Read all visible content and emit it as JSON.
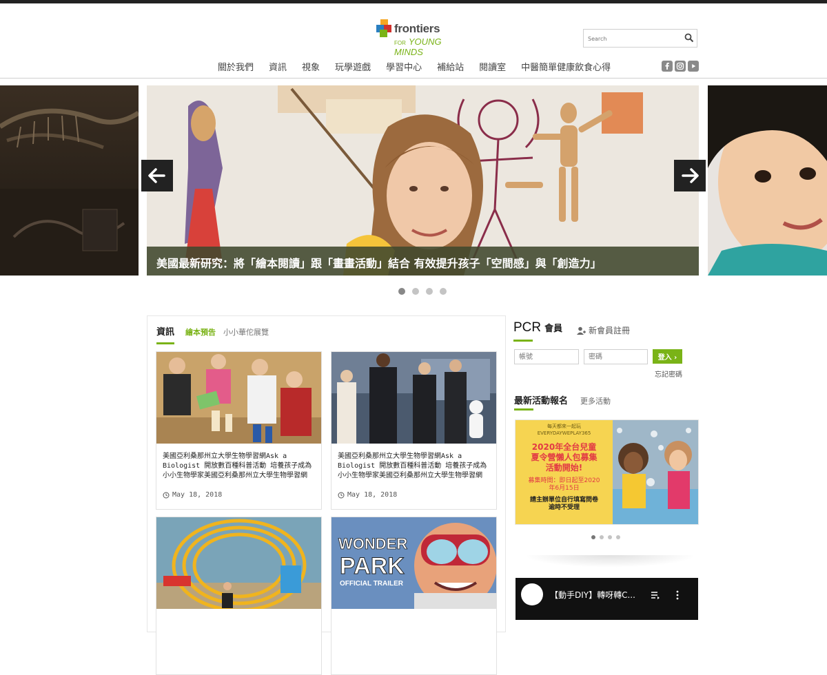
{
  "header": {
    "logo_word": "frontiers",
    "logo_for": "FOR",
    "logo_sub": "YOUNG MINDS",
    "search_placeholder": "Search"
  },
  "nav": {
    "items": [
      {
        "label": "關於我們"
      },
      {
        "label": "資訊"
      },
      {
        "label": "視象"
      },
      {
        "label": "玩學遊戲"
      },
      {
        "label": "學習中心"
      },
      {
        "label": "補給站"
      },
      {
        "label": "閱讀室"
      },
      {
        "label": "中醫簡單健康飲食心得"
      }
    ],
    "social": [
      "facebook-icon",
      "instagram-icon",
      "youtube-icon"
    ]
  },
  "hero": {
    "caption": "美國最新研究：將「繪本閱讀」跟「畫畫活動」結合 有效提升孩子「空間感」與「創造力」",
    "slide_count": 4,
    "active_index": 0
  },
  "news": {
    "section_title": "資訊",
    "tabs": [
      {
        "label": "繪本預告",
        "selected": true
      },
      {
        "label": "小小華佗展覽",
        "selected": false
      }
    ],
    "cards": [
      {
        "title": "美國亞利桑那州立大學生物學習網Ask a Biologist 開放數百種科普活動 培養孩子成為小小生物學家美國亞利桑那州立大學生物學習網",
        "date": "May 18, 2018"
      },
      {
        "title": "美國亞利桑那州立大學生物學習網Ask a Biologist 開放數百種科普活動 培養孩子成為小小生物學家美國亞利桑那州立大學生物學習網",
        "date": "May 18, 2018"
      },
      {
        "title": "",
        "date": "",
        "image_text": {
          "line1": "WONDER",
          "line2": "PARK",
          "line3": "OFFICIAL TRAILER"
        }
      }
    ]
  },
  "member": {
    "brand": "PCR",
    "label": "會員",
    "register": "新會員註冊",
    "account_placeholder": "帳號",
    "password_placeholder": "密碼",
    "login": "登入",
    "forgot": "忘記密碼"
  },
  "events": {
    "title": "最新活動報名",
    "more": "更多活動",
    "banner": {
      "brand_line1": "每天都來一起玩",
      "brand_line2": "EVERYDAYWEPLAY365",
      "headline1": "2020年全台兒童",
      "headline2": "夏令營懶人包募集",
      "headline3": "活動開始!",
      "period1": "募集時間：即日起至2020",
      "period2": "年6月15日",
      "note1": "請主辦單位自行填寫問卷",
      "note2": "逾時不受理"
    },
    "slide_count": 4,
    "active_index": 0
  },
  "video": {
    "title": "【動手DIY】轉呀轉C..."
  },
  "colors": {
    "accent_green": "#7ab317",
    "caption_bg": "#40482e",
    "banner_yellow": "#f6d451",
    "banner_red": "#e23a44"
  }
}
